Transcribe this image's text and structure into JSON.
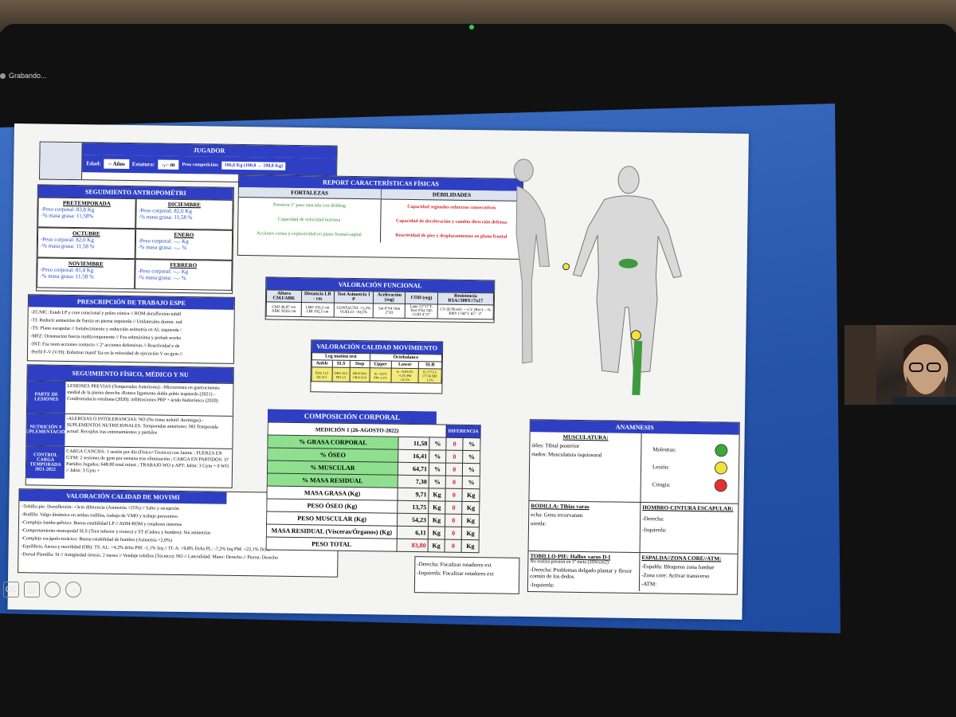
{
  "recording": "Grabando...",
  "jugador": {
    "title": "JUGADOR",
    "edad_label": "Edad:",
    "edad_value": "-- Años",
    "estatura_label": "Estatura:",
    "estatura_value": "-,-- m",
    "peso_label": "Peso competición:",
    "peso_value": "106,6 Kg (100,8 → 108,8 Kg)"
  },
  "antropo": {
    "title": "SEGUIMIENTO ANTROPOMÉTRI",
    "cells": [
      {
        "month": "PRETEMPORADA",
        "peso": "-Peso corporal: 83,8 Kg",
        "grasa": "-% masa grasa: 11,58%"
      },
      {
        "month": "DICIEMBRE",
        "peso": "-Peso corporal: 82,0 Kg",
        "grasa": "-% masa grasa: 11,58 %"
      },
      {
        "month": "OCTUBRE",
        "peso": "-Peso corporal: 82,0 Kg",
        "grasa": "-% masa grasa: 11,58 %"
      },
      {
        "month": "ENERO",
        "peso": "-Peso corporal: --,- Kg",
        "grasa": "-% masa grasa: --,- %"
      },
      {
        "month": "NOVIEMBRE",
        "peso": "-Peso corporal: 81,4 Kg",
        "grasa": "-% masa grasa: 11,58 %"
      },
      {
        "month": "FEBRERO",
        "peso": "-Peso corporal: --,- Kg",
        "grasa": "-% masa grasa: --,- %"
      }
    ]
  },
  "prescripcion": {
    "title": "PRESCRIPCIÓN DE TRABAJO ESPE",
    "lines": [
      "-ZC/MC: Estab LP y core rotacional y poleo cónica // ROM dorsiflexión tobill",
      "-TI: Reducir asimetrías de fuerza en pierna izquierda // Unilaterales domin. rod",
      "-TS: Plano escapular // fortalecimiento y reducción asimetría en AL izquierda /",
      "-MFZ: Orientación fuerza multicomponente // Fza submáxima y prehab worko",
      "-INT: Fza isom acciones contacto // 2ª acciones defensivas // Reactividad y de",
      "-Perfil F-V (V/H): Enfatizar manif fza en la velocidad de ejecución V en gym //"
    ]
  },
  "seguimiento": {
    "title": "SEGUIMIENTO FÍSICO, MÉDICO Y NU",
    "rows": [
      {
        "label": "PARTE DE LESIONES",
        "text": "LESIONES PREVIAS (Temporadas Anteriores): -Microrotura en gastrocnemio medial de la pierna derecha -Rotura ligamento doble pubis izquierdo (2021) -Condromalacia rotuliana (2020): infiltraciones PRP + ácido hialurónico (2020)"
      },
      {
        "label": "NUTRICIÓN Y SUPLEMENTACIÓN",
        "text": "-ALERGIAS O INTOLERANCIAS: NO (No toma nolotil -hormigas) -SUPLEMENTOS NUTRICIONALES: Temporadas anteriores: NO Temporada actual: Recoplus tras entrenamientos y partidos"
      },
      {
        "label": "CONTROL CARGA TEMPORADA 2021-2022",
        "text": "CARGA CANCHA: 1 sesión por día (Físico+Técnico) con Jaume ; FUERZA EN GYM: 2 sesiones de gym por semana tras eliminación ; CARGA EN PARTIDOS: 37 Partidos Jugados; 648:00 total minut ; TRABAJO WO y APT: Jalón: 3 Gym + 0 WO // Jalón: 3 Gym +"
      }
    ]
  },
  "valoracion_mov": {
    "title": "VALORACIÓN CALIDAD DE MOVIMI",
    "lines": [
      "-Tobillo-pie: Dorsiflexión: +3cm diferencia (Asimetría +25%) // Salto y recepción",
      "-Rodilla: Valgo dinámico en ambas rodillas, trabajo de VMO y trabajo preventivo",
      "-Complejo lumbo-pélvico: Buena estabilidad LP // ADM-ROM y rotadores internos",
      "-Comportamiento monopodal SLS (Tren inferior y tronco) y ST (Cadera y hombro): Sin asimetrías",
      "-Complejo escápulo-torácico: Buena estabilidad de hombro (Asimetría +2,0%)",
      "-Equilibrio, fuerza y movilidad (OB): TS: AL: +4,2% dcha PM: -1,1% Izq // TI: A: +9,8% Dcha PL: -7,2% Izq PM: +22,1% Dcha",
      "-Dorsal Plantilla: SI // Antigüedad órtesis: 2 meses // Vendaje tobillos (Técnico): NO // Lateralidad: Mano: Derecho // Pierna: Derecho"
    ]
  },
  "report": {
    "title": "REPORT CARACTERÍSTICAS FÍSICAS",
    "fortalezas_label": "FORTALEZAS",
    "debilidades_label": "DEBILIDADES",
    "fortalezas": [
      "Potencia 1º paso zancada con dribling",
      "Capacidad de velocidad máxima",
      "Acciones cortas y explosividad en plano frontal-sagital"
    ],
    "debilidades": [
      "Capacidad segundos esfuerzos consecutivos",
      "Capacidad de deceleración y cambio dirección defensa",
      "Reactividad de pies y desplazamientos en plano frontal"
    ]
  },
  "funcional": {
    "title": "VALORACIÓN FUNCIONAL",
    "headers": [
      "Altura CMJ/ABK",
      "Distancia LB - cm",
      "Test Asimetría 1 P",
      "Aceleración (seg)",
      "COD (seg)",
      "Resistencia RSA//300Y//7x17"
    ],
    "values": [
      "CMJ 46,87 cm ABK 50,62 cm",
      "LBD 193,2 cm LBI 192,5 cm",
      "CONTACTO: +1,2% VUELO: -10,5%",
      "5m 0\"94 10m 2\"03",
      "Lane 13\"17 T-Test 9\"62 505 COD 4\"27",
      "CV (E/Nivel): -- CV (Rec): --% 300Y (<60\"): 65\" -3\""
    ]
  },
  "calidad_mov": {
    "title": "VALORACIÓN CALIDAD MOVIMIENTO",
    "group1": "Leg motion test",
    "group2": "Octebalance",
    "headers": [
      "Ankle",
      "SLS",
      "Step",
      "Upper",
      "Lower",
      "SLB"
    ],
    "values": [
      "Dcha 11,5 Izq 10,5",
      "DRA 10,5 IZQ 1,5",
      "HD-0 HI-0 CB-0 CI-0",
      "Ar +4,2% PM -1,1%",
      "A: +9,8% PL -7,2% PM +22,1%",
      "D: 177,5 I: 177,56 DIF: 1,2%"
    ]
  },
  "composicion": {
    "title": "COMPOSICIÓN CORPORAL",
    "medicion": "MEDICIÓN 1 (26-AGOSTO-2022)",
    "diferencia": "DIFERENCIA",
    "rows": [
      {
        "label": "% GRASA CORPORAL",
        "value": "11,58",
        "unit": "%",
        "diff": "0",
        "dunit": "%",
        "green": true
      },
      {
        "label": "% ÓSEO",
        "value": "16,41",
        "unit": "%",
        "diff": "0",
        "dunit": "%",
        "green": true
      },
      {
        "label": "% MUSCULAR",
        "value": "64,71",
        "unit": "%",
        "diff": "0",
        "dunit": "%",
        "green": true
      },
      {
        "label": "% MASA RESIDUAL",
        "value": "7,30",
        "unit": "%",
        "diff": "0",
        "dunit": "%",
        "green": true
      },
      {
        "label": "MASA GRASA (Kg)",
        "value": "9,71",
        "unit": "Kg",
        "diff": "0",
        "dunit": "Kg",
        "green": false
      },
      {
        "label": "PESO ÓSEO (Kg)",
        "value": "13,75",
        "unit": "Kg",
        "diff": "0",
        "dunit": "Kg",
        "green": false
      },
      {
        "label": "PESO MUSCULAR (Kg)",
        "value": "54,23",
        "unit": "Kg",
        "diff": "0",
        "dunit": "Kg",
        "green": false
      },
      {
        "label": "MASA RESIDUAL (Vísceras/Órganos) (Kg)",
        "value": "6,11",
        "unit": "Kg",
        "diff": "0",
        "dunit": "Kg",
        "green": false
      },
      {
        "label": "PESO TOTAL",
        "value": "83,80",
        "unit": "Kg",
        "diff": "0",
        "dunit": "Kg",
        "green": false
      }
    ]
  },
  "anamnesis": {
    "title": "ANAMNESIS",
    "musculatura": "MUSCULATURA:",
    "lines1": [
      "óiles: Tibial posterior",
      "rtados: Musculatura isquiosural"
    ],
    "rodilla": "RODILLA: Tibias varas",
    "lines2": [
      "echa: Genu recurvatum",
      "uierda:"
    ],
    "tobillo": "TOBILLO-PIE: Hallux varus D-I",
    "tobillo_note": "No realiza presión en 1º meta (20N/cm2)",
    "lines3": [
      "-Derecha: Problemas delgado plantar y flexor común de los dedos",
      "-Izquierda:"
    ],
    "legend": [
      "Molestias:",
      "Lesión:",
      "Cirugía:"
    ],
    "legend_colors": [
      "#3aa83a",
      "#f2e33a",
      "#e53030"
    ],
    "hombro": "HOMBRO-CINTURA ESCAPULAR:",
    "hombro_lines": [
      "-Derecha:",
      "-Izquierda:"
    ],
    "espalda": "ESPALDA//ZONA CORE//ATM:",
    "espalda_lines": [
      "-Espalda: Bloqueos zona lumbar",
      "-Zona core: Activar transverso",
      "-ATM:"
    ]
  },
  "hombro_focus": [
    "-Derecha: Focalizar rotadores ext",
    "-Izquierda: Focalizar rotadores ext"
  ]
}
